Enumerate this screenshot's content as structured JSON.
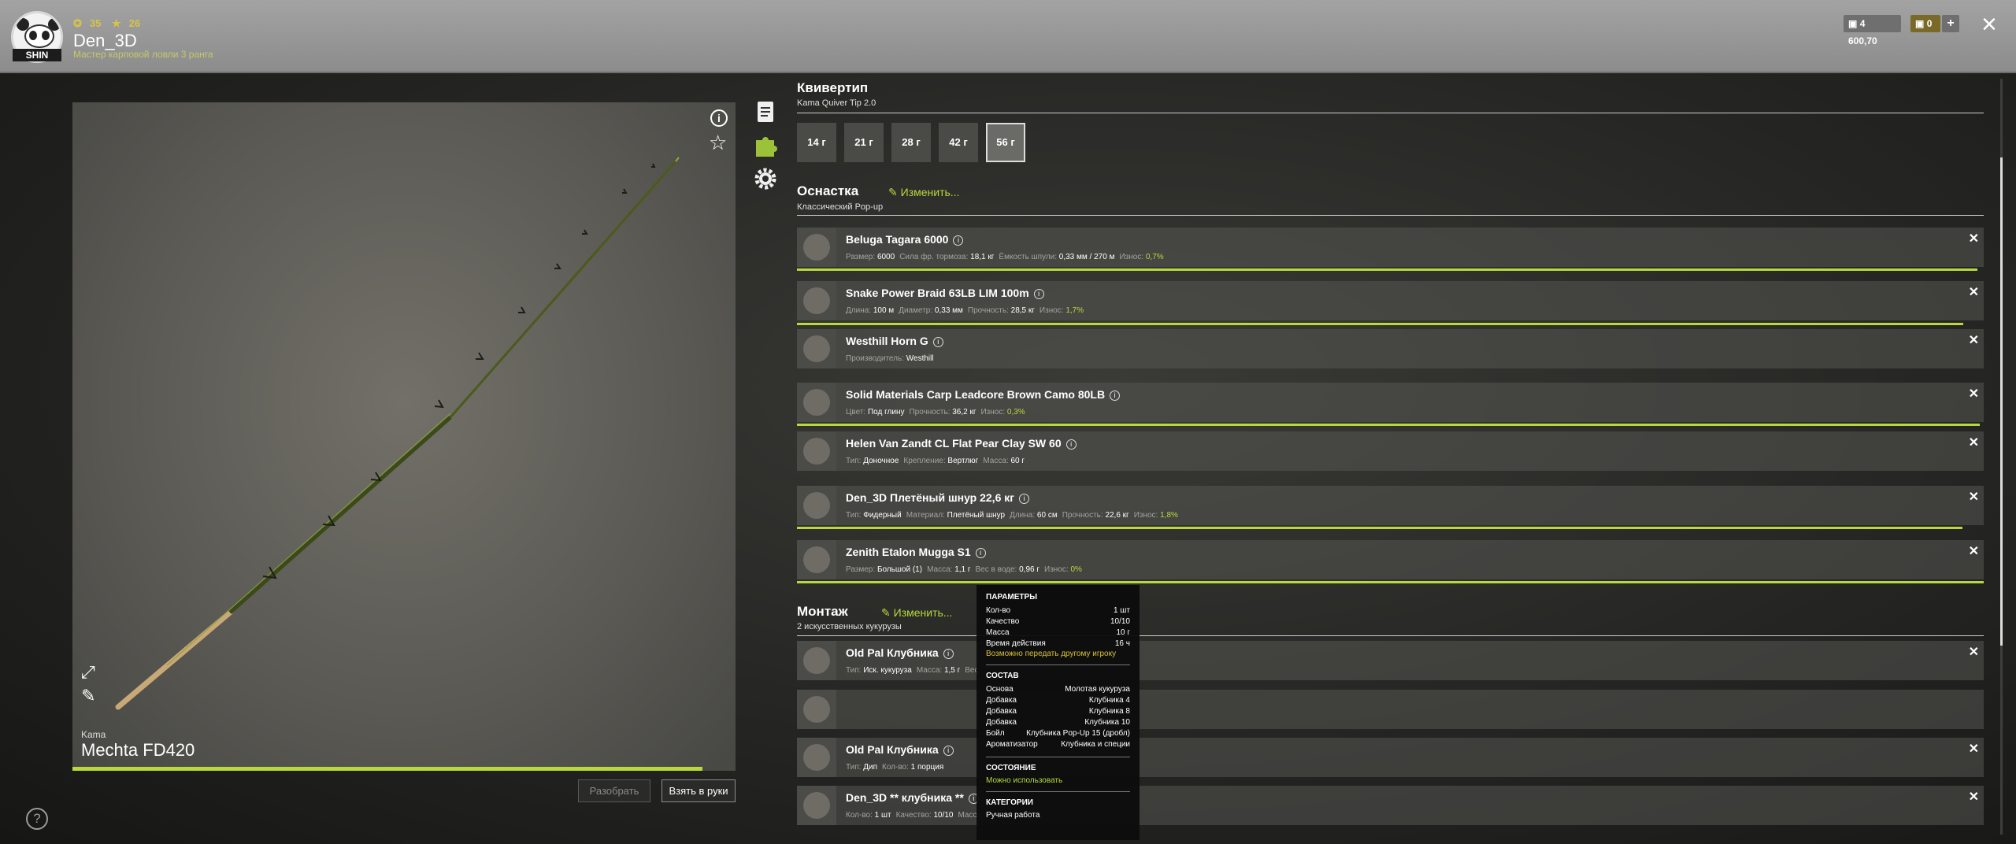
{
  "header": {
    "player": {
      "name": "Den_3D",
      "rank": "Мастер карповой ловли 3 ранга",
      "level": "35",
      "stars": "26",
      "avatar_tag": "SHIN"
    },
    "currency": {
      "silver": "4 600,70",
      "gold": "0"
    }
  },
  "rod": {
    "brand": "Kama",
    "name": "Mechta FD420",
    "wear_fraction": 0.95,
    "buttons": {
      "disassemble": "Разобрать",
      "take": "Взять в руки"
    }
  },
  "quivertip": {
    "title": "Квивертип",
    "subtitle": "Kama Quiver Tip 2.0",
    "weights": [
      "14 г",
      "21 г",
      "28 г",
      "42 г",
      "56 г"
    ],
    "selected": "56 г"
  },
  "tackle": {
    "title": "Оснастка",
    "edit_label": "Изменить...",
    "subtitle": "Классический Pop-up",
    "items": [
      {
        "title": "Beluga Tagara 6000",
        "props": [
          [
            "Размер:",
            "6000"
          ],
          [
            "Сила фр. тормоза:",
            "18,1 кг"
          ],
          [
            "Ёмкость шпули:",
            "0,33 мм / 270 м"
          ],
          [
            "Износ:",
            "0,7%"
          ]
        ],
        "wear": 0.995
      },
      {
        "title": "Snake Power Braid 63LB LIM 100m",
        "props": [
          [
            "Длина:",
            "100 м"
          ],
          [
            "Диаметр:",
            "0,33 мм"
          ],
          [
            "Прочность:",
            "28,5 кг"
          ],
          [
            "Износ:",
            "1,7%"
          ]
        ],
        "wear": 0.983
      },
      {
        "title": "Westhill Horn G",
        "props": [
          [
            "Производитель:",
            "Westhill"
          ]
        ]
      },
      {
        "title": "Solid Materials Carp Leadcore Brown Camo 80LB",
        "props": [
          [
            "Цвет:",
            "Под глину"
          ],
          [
            "Прочность:",
            "36,2 кг"
          ],
          [
            "Износ:",
            "0,3%"
          ]
        ],
        "wear": 0.997
      },
      {
        "title": "Helen Van Zandt CL Flat Pear Clay SW 60",
        "props": [
          [
            "Тип:",
            "Доночное"
          ],
          [
            "Крепление:",
            "Вертлюг"
          ],
          [
            "Масса:",
            "60 г"
          ]
        ]
      },
      {
        "title": "Den_3D Плетёный шнур 22,6 кг",
        "props": [
          [
            "Тип:",
            "Фидерный"
          ],
          [
            "Материал:",
            "Плетёный шнур"
          ],
          [
            "Длина:",
            "60 см"
          ],
          [
            "Прочность:",
            "22,6 кг"
          ],
          [
            "Износ:",
            "1,8%"
          ]
        ],
        "wear": 0.982
      },
      {
        "title": "Zenith Etalon Mugga S1",
        "props": [
          [
            "Размер:",
            "Большой (1)"
          ],
          [
            "Масса:",
            "1,1 г"
          ],
          [
            "Вес в воде:",
            "0,96 г"
          ],
          [
            "Износ:",
            "0%"
          ]
        ],
        "wear": 1.0
      }
    ]
  },
  "mount": {
    "title": "Монтаж",
    "edit_label": "Изменить...",
    "subtitle": "2 искусственных кукурузы",
    "items": [
      {
        "title": "Old Pal Клубника",
        "props": [
          [
            "Тип:",
            "Иск. кукуруза"
          ],
          [
            "Масса:",
            "1,5 г"
          ],
          [
            "Вес...",
            ""
          ]
        ]
      },
      {
        "title": "",
        "props": []
      },
      {
        "title": "Old Pal Клубника",
        "props": [
          [
            "Тип:",
            "Дип"
          ],
          [
            "Кол-во:",
            "1 порция"
          ]
        ]
      },
      {
        "title": "Den_3D ** клубника **",
        "props": [
          [
            "Кол-во:",
            "1 шт"
          ],
          [
            "Качество:",
            "10/10"
          ],
          [
            "Масса...",
            ""
          ]
        ]
      }
    ]
  },
  "tooltip": {
    "params_title": "ПАРАМЕТРЫ",
    "params": [
      [
        "Кол-во",
        "1 шт"
      ],
      [
        "Качество",
        "10/10"
      ],
      [
        "Масса",
        "10 г"
      ],
      [
        "Время действия",
        "16 ч"
      ]
    ],
    "transfer_note": "Возможно передать другому игроку",
    "composition_title": "СОСТАВ",
    "composition": [
      [
        "Основа",
        "Молотая кукуруза"
      ],
      [
        "Добавка",
        "Клубника 4"
      ],
      [
        "Добавка",
        "Клубника 8"
      ],
      [
        "Добавка",
        "Клубника 10"
      ],
      [
        "Бойл",
        "Клубника Pop-Up 15 (дробл)"
      ],
      [
        "Ароматизатор",
        "Клубника и специи"
      ]
    ],
    "state_title": "СОСТОЯНИЕ",
    "state": "Можно использовать",
    "categories_title": "КАТЕГОРИИ",
    "category": "Ручная работа"
  },
  "colors": {
    "accent": "#b7d93c",
    "gold": "#d9c236"
  }
}
